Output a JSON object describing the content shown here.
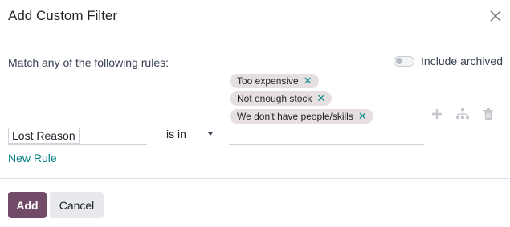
{
  "dialog": {
    "title": "Add Custom Filter"
  },
  "body": {
    "match_label": "Match any of the following rules:",
    "include_archived_label": "Include archived",
    "include_archived_on": false
  },
  "rule": {
    "field": "Lost Reason",
    "operator": "is in",
    "tags": [
      {
        "label": "Too expensive"
      },
      {
        "label": "Not enough stock"
      },
      {
        "label": "We don't have people/skills"
      }
    ],
    "actions": {
      "add_icon": "plus-icon",
      "branch_icon": "sitemap-icon",
      "delete_icon": "trash-icon"
    }
  },
  "new_rule_label": "New Rule",
  "footer": {
    "add_label": "Add",
    "cancel_label": "Cancel"
  },
  "colors": {
    "primary": "#714b67",
    "link": "#017e84",
    "tag_bg": "#e6dfe0",
    "tag_x": "#0e8a8e"
  }
}
